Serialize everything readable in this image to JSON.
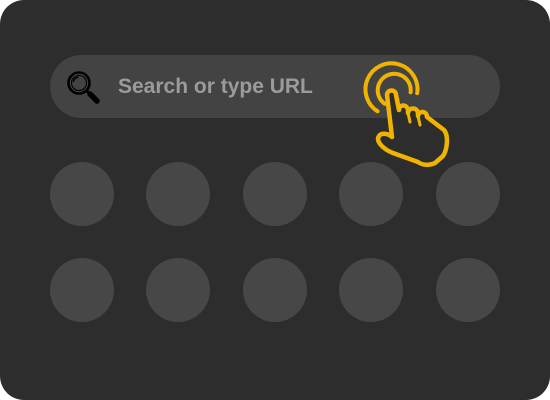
{
  "search": {
    "placeholder": "Search or type URL",
    "icon": "search-icon"
  },
  "shortcuts": {
    "rows": 2,
    "per_row": 5
  },
  "cursor": {
    "icon": "tap-hand-icon",
    "color": "#f0b400"
  },
  "colors": {
    "background": "#2d2d2d",
    "search_bar": "#434343",
    "shortcut": "#474747",
    "placeholder_text": "#9b9b9b",
    "accent": "#f0b400"
  }
}
